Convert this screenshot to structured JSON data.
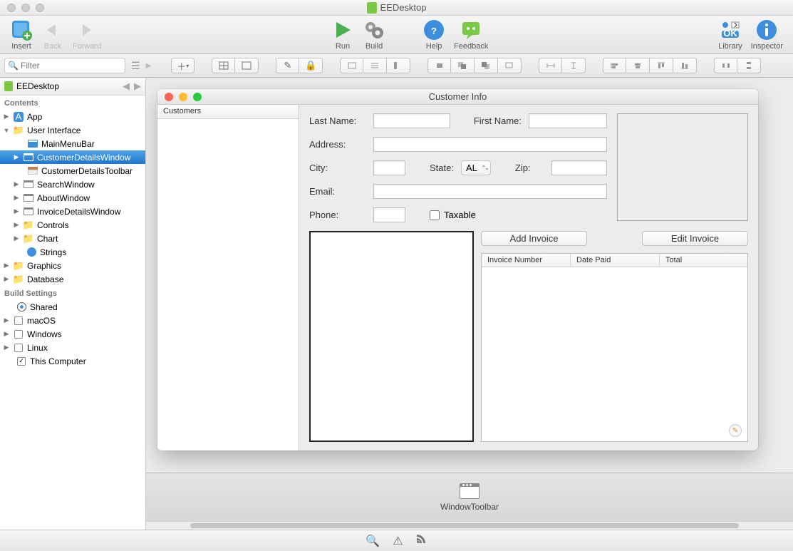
{
  "app": {
    "title": "EEDesktop"
  },
  "toolbar": {
    "insert": "Insert",
    "back": "Back",
    "forward": "Forward",
    "run": "Run",
    "build": "Build",
    "help": "Help",
    "feedback": "Feedback",
    "library": "Library",
    "inspector": "Inspector"
  },
  "filter": {
    "placeholder": "Filter"
  },
  "project": {
    "name": "EEDesktop"
  },
  "sections": {
    "contents": "Contents",
    "build_settings": "Build Settings"
  },
  "tree": {
    "app": "App",
    "ui": "User Interface",
    "mainmenu": "MainMenuBar",
    "custwindow": "CustomerDetailsWindow",
    "custtoolbar": "CustomerDetailsToolbar",
    "searchwin": "SearchWindow",
    "aboutwin": "AboutWindow",
    "invoicewin": "InvoiceDetailsWindow",
    "controls": "Controls",
    "chart": "Chart",
    "strings": "Strings",
    "graphics": "Graphics",
    "database": "Database"
  },
  "build": {
    "shared": "Shared",
    "macos": "macOS",
    "windows": "Windows",
    "linux": "Linux",
    "this_computer": "This Computer"
  },
  "window": {
    "title": "Customer Info",
    "customers_header": "Customers",
    "last_name": "Last Name:",
    "first_name": "First Name:",
    "address": "Address:",
    "city": "City:",
    "state": "State:",
    "state_value": "AL",
    "zip": "Zip:",
    "email": "Email:",
    "phone": "Phone:",
    "taxable": "Taxable",
    "add_invoice": "Add Invoice",
    "edit_invoice": "Edit Invoice",
    "col_invoice": "Invoice Number",
    "col_date": "Date Paid",
    "col_total": "Total"
  },
  "tray": {
    "window_toolbar": "WindowToolbar"
  }
}
